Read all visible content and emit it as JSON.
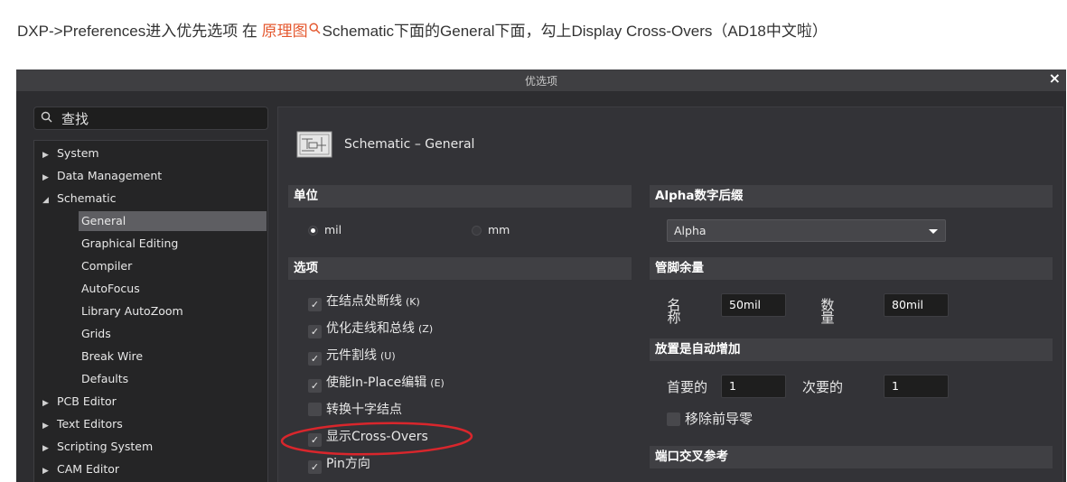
{
  "caption": {
    "before": "DXP->Preferences进入优先选项 在 ",
    "link": "原理图",
    "after": "Schematic下面的General下面，勾上Display Cross-Overs（AD18中文啦）"
  },
  "dialog": {
    "title": "优选项",
    "close_glyph": "×",
    "search_placeholder": "查找",
    "tree": [
      {
        "label": "System",
        "level": 0,
        "state": "collapsed"
      },
      {
        "label": "Data Management",
        "level": 0,
        "state": "collapsed"
      },
      {
        "label": "Schematic",
        "level": 0,
        "state": "expanded"
      },
      {
        "label": "General",
        "level": 1,
        "selected": true
      },
      {
        "label": "Graphical Editing",
        "level": 1
      },
      {
        "label": "Compiler",
        "level": 1
      },
      {
        "label": "AutoFocus",
        "level": 1
      },
      {
        "label": "Library AutoZoom",
        "level": 1
      },
      {
        "label": "Grids",
        "level": 1
      },
      {
        "label": "Break Wire",
        "level": 1
      },
      {
        "label": "Defaults",
        "level": 1
      },
      {
        "label": "PCB Editor",
        "level": 0,
        "state": "collapsed"
      },
      {
        "label": "Text Editors",
        "level": 0,
        "state": "collapsed"
      },
      {
        "label": "Scripting System",
        "level": 0,
        "state": "collapsed"
      },
      {
        "label": "CAM Editor",
        "level": 0,
        "state": "collapsed"
      }
    ],
    "panel": {
      "title": "Schematic – General",
      "units": {
        "header": "单位",
        "mil": "mil",
        "mm": "mm",
        "selected": "mil"
      },
      "options": {
        "header": "选项",
        "items": [
          {
            "label": "在结点处断线",
            "key": "(K)",
            "checked": true
          },
          {
            "label": "优化走线和总线",
            "key": "(Z)",
            "checked": true
          },
          {
            "label": "元件割线",
            "key": "(U)",
            "checked": true
          },
          {
            "label": "使能In-Place编辑",
            "key": "(E)",
            "checked": true
          },
          {
            "label": "转换十字结点",
            "key": "",
            "checked": false
          },
          {
            "label": "显示Cross-Overs",
            "key": "",
            "checked": true
          },
          {
            "label": "Pin方向",
            "key": "",
            "checked": true
          }
        ]
      },
      "alpha": {
        "header": "Alpha数字后缀",
        "value": "Alpha"
      },
      "pin_margin": {
        "header": "管脚余量",
        "name_label": "名称",
        "name_value": "50mil",
        "number_label": "数量",
        "number_value": "80mil"
      },
      "auto_increment": {
        "header": "放置是自动增加",
        "primary_label": "首要的",
        "primary_value": "1",
        "secondary_label": "次要的",
        "secondary_value": "1",
        "remove_zeros_label": "移除前导零",
        "remove_zeros_checked": false
      },
      "port_ref": {
        "header": "端口交叉参考"
      }
    }
  },
  "colors": {
    "link": "#e4582f",
    "annotation": "#d9262c",
    "dialog_bg": "#2d2d30",
    "section_header": "#404044",
    "selected_item": "#5e5e62"
  }
}
